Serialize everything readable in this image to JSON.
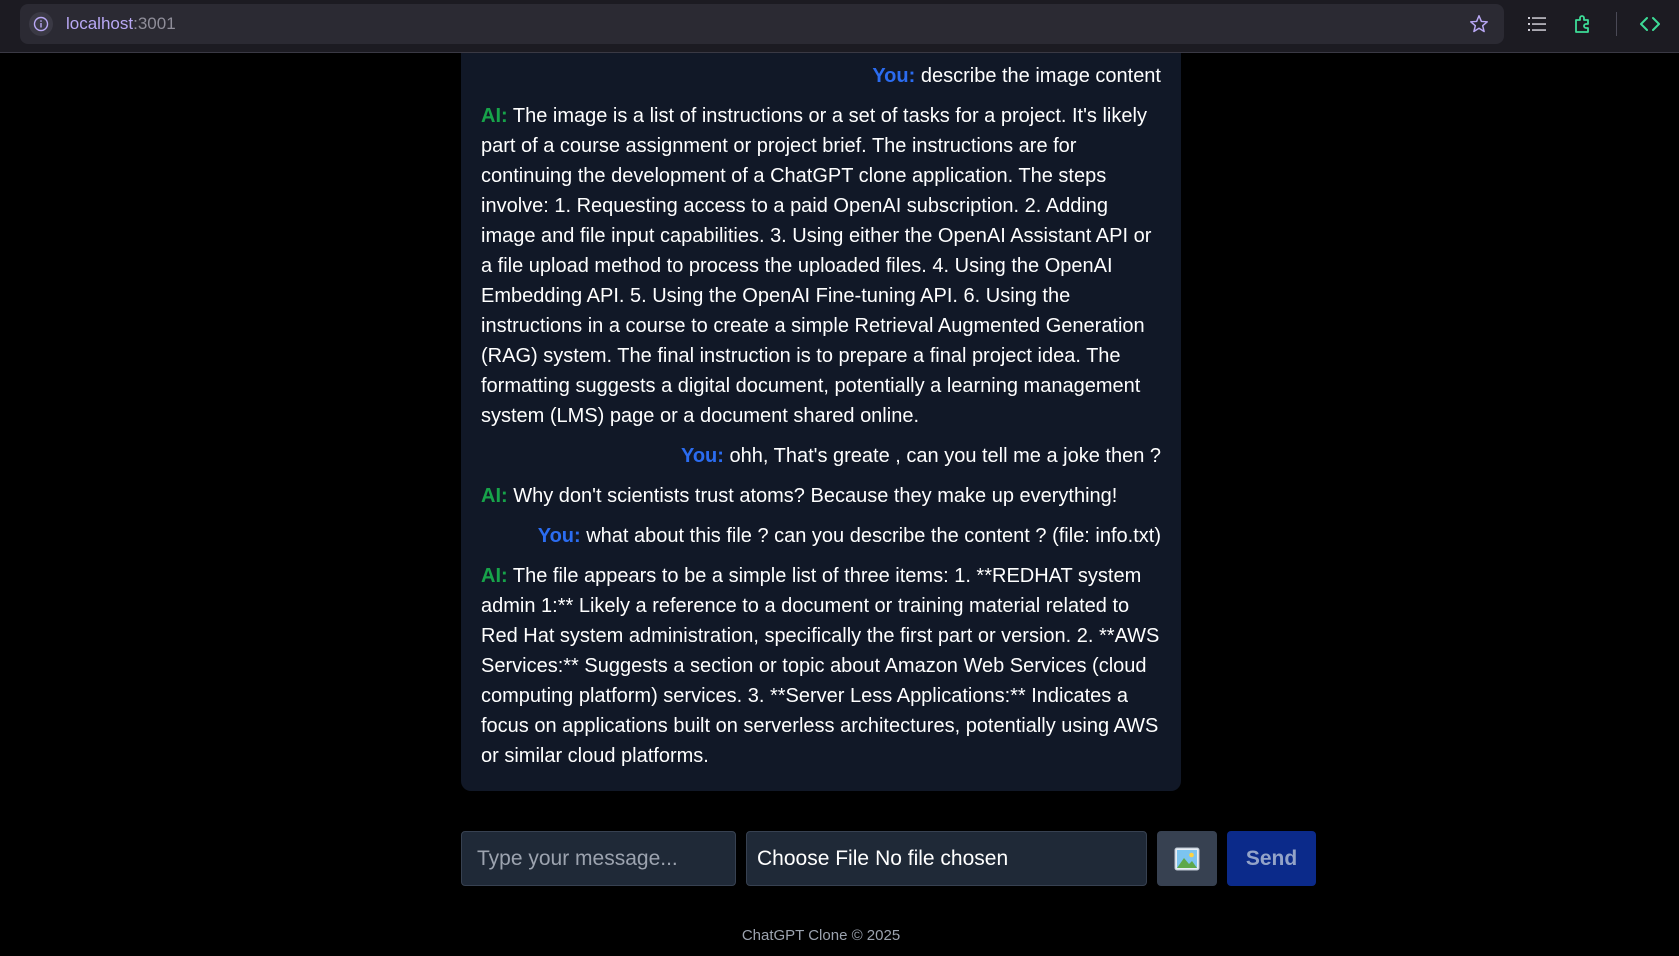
{
  "browser": {
    "url_host": "localhost",
    "url_port": ":3001",
    "icons": [
      "info-icon",
      "star-icon",
      "list-icon",
      "extension-icon",
      "code-icon"
    ]
  },
  "chat": {
    "messages": [
      {
        "role": "user",
        "speaker": "You:",
        "text": "describe the image content"
      },
      {
        "role": "ai",
        "speaker": "AI:",
        "text": "The image is a list of instructions or a set of tasks for a project. It's likely part of a course assignment or project brief. The instructions are for continuing the development of a ChatGPT clone application. The steps involve: 1. Requesting access to a paid OpenAI subscription. 2. Adding image and file input capabilities. 3. Using either the OpenAI Assistant API or a file upload method to process the uploaded files. 4. Using the OpenAI Embedding API. 5. Using the OpenAI Fine-tuning API. 6. Using the instructions in a course to create a simple Retrieval Augmented Generation (RAG) system. The final instruction is to prepare a final project idea. The formatting suggests a digital document, potentially a learning management system (LMS) page or a document shared online."
      },
      {
        "role": "user",
        "speaker": "You:",
        "text": "ohh, That's greate , can you tell me a joke then ?"
      },
      {
        "role": "ai",
        "speaker": "AI:",
        "text": "Why don't scientists trust atoms? Because they make up everything!"
      },
      {
        "role": "user",
        "speaker": "You:",
        "text": "what about this file ? can you describe the content ? (file: info.txt)"
      },
      {
        "role": "ai",
        "speaker": "AI:",
        "text": "The file appears to be a simple list of three items: 1. **REDHAT system admin 1:** Likely a reference to a document or training material related to Red Hat system administration, specifically the first part or version. 2. **AWS Services:** Suggests a section or topic about Amazon Web Services (cloud computing platform) services. 3. **Server Less Applications:** Indicates a focus on applications built on serverless architectures, potentially using AWS or similar cloud platforms."
      }
    ]
  },
  "composer": {
    "placeholder": "Type your message...",
    "file_button": "Choose File",
    "file_status": "No file chosen",
    "image_icon": "picture-icon",
    "send_label": "Send"
  },
  "footer": {
    "text": "ChatGPT Clone © 2025"
  },
  "colors": {
    "user_accent": "#2b6cf0",
    "ai_accent": "#17a34a",
    "panel_bg": "#111827",
    "send_bg": "#0b2a8a"
  }
}
